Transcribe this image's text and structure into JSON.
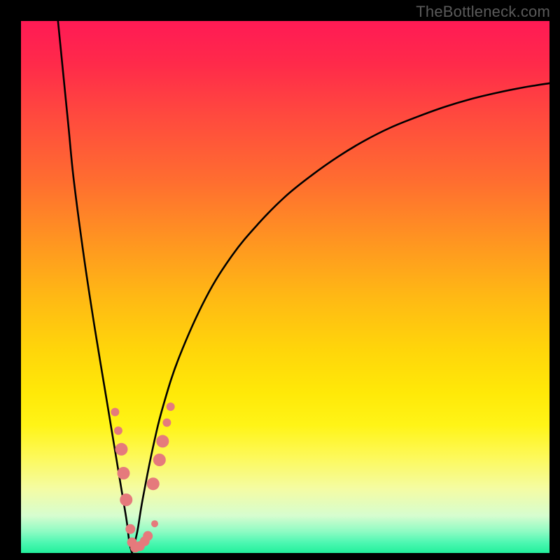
{
  "watermark": "TheBottleneck.com",
  "chart_data": {
    "type": "line",
    "title": "",
    "xlabel": "",
    "ylabel": "",
    "xlim": [
      0,
      100
    ],
    "ylim": [
      0,
      100
    ],
    "series": [
      {
        "name": "left-branch",
        "x": [
          7,
          8,
          9,
          10,
          12,
          14,
          16,
          18,
          19,
          20,
          20.5,
          21
        ],
        "y": [
          100,
          90,
          80,
          70,
          55,
          42,
          30,
          18,
          12,
          6,
          2,
          0
        ]
      },
      {
        "name": "right-branch",
        "x": [
          21,
          22,
          23,
          25,
          27,
          30,
          35,
          40,
          45,
          50,
          55,
          60,
          65,
          70,
          75,
          80,
          85,
          90,
          95,
          100
        ],
        "y": [
          0,
          4,
          10,
          20,
          28,
          37,
          48,
          56,
          62,
          67,
          71,
          74.5,
          77.5,
          80,
          82,
          83.8,
          85.3,
          86.5,
          87.5,
          88.3
        ]
      }
    ],
    "cluster_points": {
      "name": "pink-dots",
      "color": "#e57a7c",
      "points": [
        {
          "x": 17.8,
          "y": 26.5,
          "r": 6
        },
        {
          "x": 18.4,
          "y": 23.0,
          "r": 6
        },
        {
          "x": 20.7,
          "y": 4.5,
          "r": 7
        },
        {
          "x": 21.0,
          "y": 2.0,
          "r": 7
        },
        {
          "x": 21.6,
          "y": 1.0,
          "r": 7
        },
        {
          "x": 22.5,
          "y": 1.3,
          "r": 7
        },
        {
          "x": 23.4,
          "y": 2.2,
          "r": 7
        },
        {
          "x": 24.0,
          "y": 3.2,
          "r": 7
        },
        {
          "x": 25.3,
          "y": 5.5,
          "r": 5
        },
        {
          "x": 27.6,
          "y": 24.5,
          "r": 6
        },
        {
          "x": 28.3,
          "y": 27.5,
          "r": 6
        },
        {
          "x": 19.0,
          "y": 19.5,
          "r": 9
        },
        {
          "x": 19.4,
          "y": 15.0,
          "r": 9
        },
        {
          "x": 19.9,
          "y": 10.0,
          "r": 9
        },
        {
          "x": 26.2,
          "y": 17.5,
          "r": 9
        },
        {
          "x": 26.8,
          "y": 21.0,
          "r": 9
        },
        {
          "x": 25.0,
          "y": 13.0,
          "r": 9
        }
      ]
    },
    "gradient_colors": {
      "top": "#ff1a55",
      "mid_upper": "#ff6d30",
      "mid": "#ffd60a",
      "mid_lower": "#f4fca4",
      "bottom": "#22f09c"
    }
  }
}
